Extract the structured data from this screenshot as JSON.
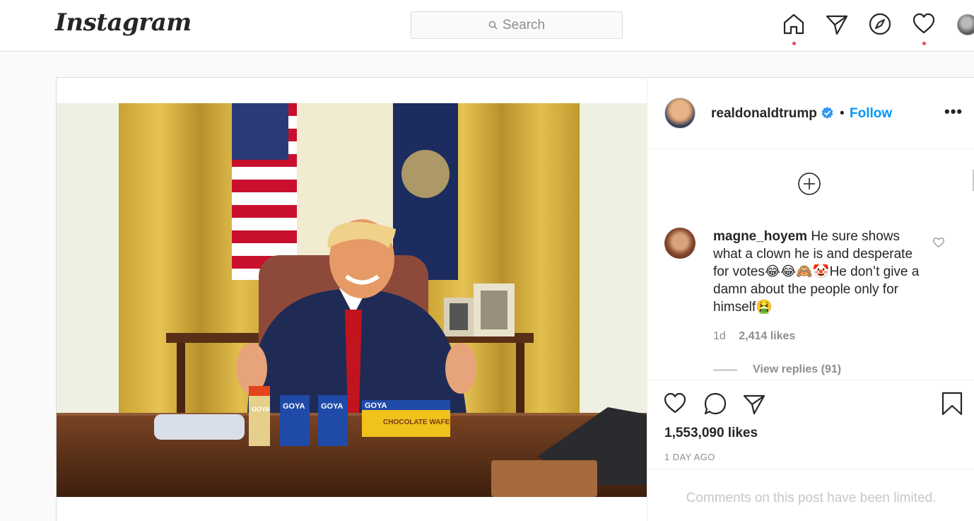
{
  "nav": {
    "logo": "Instagram",
    "search": {
      "placeholder": "Search"
    },
    "icons": [
      "home-icon",
      "direct-icon",
      "explore-icon",
      "activity-heart-icon",
      "profile-avatar"
    ]
  },
  "post": {
    "author": "realdonaldtrump",
    "verified": true,
    "separator": "•",
    "follow_label": "Follow",
    "more_label": "•••",
    "image": {
      "desk_items": [
        "GOYA",
        "GOYA",
        "GOYA",
        "GOYA"
      ],
      "cookie_box_label": "CHOCOLATE WAFERS"
    },
    "comment": {
      "user": "magne_hoyem",
      "text": "He sure shows what a clown he is and desperate for votes😂😂🙈🤡He don’t give a damn about the people only for himself🤮",
      "age": "1d",
      "likes": "2,414 likes",
      "view_replies": "View replies (91)"
    },
    "likes": "1,553,090 likes",
    "timestamp": "1 DAY AGO",
    "comments_limited": "Comments on this post have been limited."
  },
  "colors": {
    "accent": "#0095f6",
    "notification_dot": "#ed4956",
    "border": "#dbdbdb",
    "muted_text": "#8e8e8e"
  }
}
